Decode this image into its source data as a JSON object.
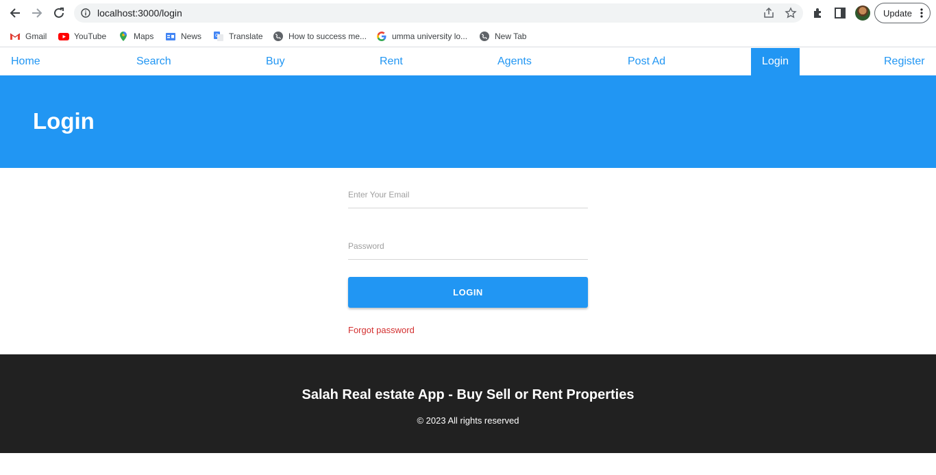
{
  "browser": {
    "url": "localhost:3000/login",
    "update_label": "Update",
    "bookmarks": [
      {
        "label": "Gmail",
        "icon": "gmail-icon"
      },
      {
        "label": "YouTube",
        "icon": "youtube-icon"
      },
      {
        "label": "Maps",
        "icon": "maps-icon"
      },
      {
        "label": "News",
        "icon": "news-icon"
      },
      {
        "label": "Translate",
        "icon": "translate-icon"
      },
      {
        "label": "How to success me...",
        "icon": "globe-icon"
      },
      {
        "label": "umma university lo...",
        "icon": "google-icon"
      },
      {
        "label": "New Tab",
        "icon": "globe-icon"
      }
    ]
  },
  "nav": {
    "items": [
      {
        "label": "Home",
        "active": false
      },
      {
        "label": "Search",
        "active": false
      },
      {
        "label": "Buy",
        "active": false
      },
      {
        "label": "Rent",
        "active": false
      },
      {
        "label": "Agents",
        "active": false
      },
      {
        "label": "Post Ad",
        "active": false
      },
      {
        "label": "Login",
        "active": true
      },
      {
        "label": "Register",
        "active": false
      }
    ]
  },
  "hero": {
    "title": "Login"
  },
  "form": {
    "email_placeholder": "Enter Your Email",
    "email_value": "",
    "password_placeholder": "Password",
    "password_value": "",
    "login_label": "LOGIN",
    "forgot_label": "Forgot password"
  },
  "footer": {
    "title": "Salah Real estate App - Buy Sell or Rent Properties",
    "copyright": "© 2023 All rights reserved"
  },
  "colors": {
    "primary": "#2196f3",
    "footer_bg": "#212121",
    "link_red": "#d32f2f"
  }
}
